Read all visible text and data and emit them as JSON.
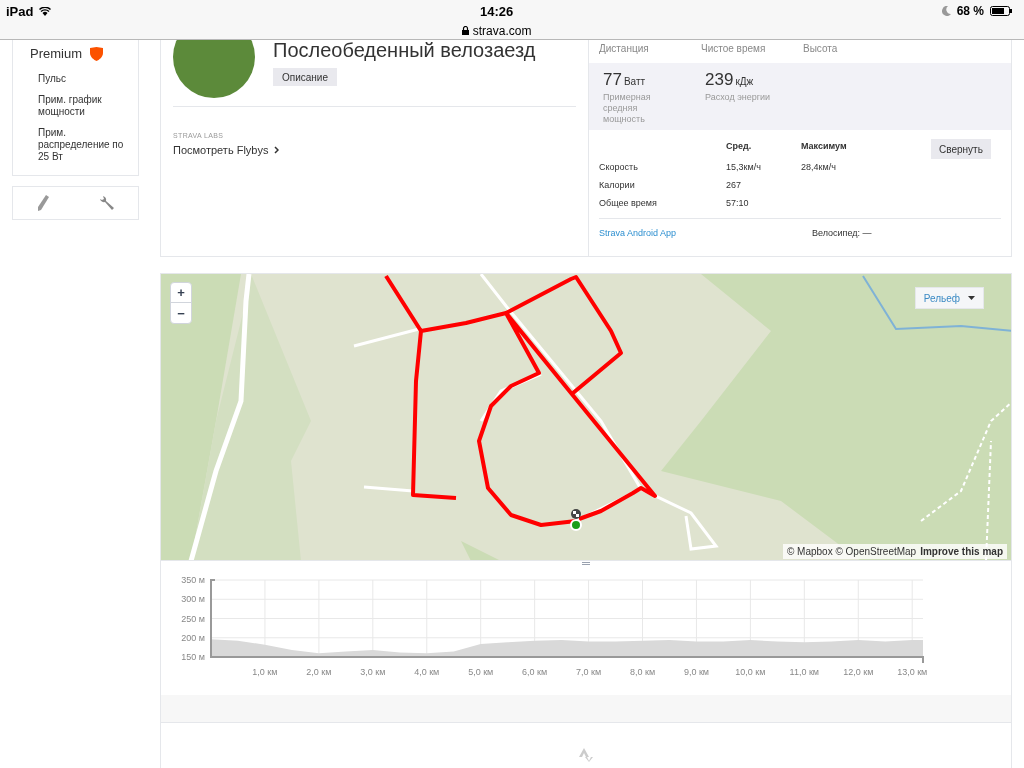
{
  "status_bar": {
    "device": "iPad",
    "time": "14:26",
    "url": "strava.com",
    "battery": "68 %"
  },
  "sidebar": {
    "premium": {
      "title": "Premium",
      "items": [
        "Пульс",
        "Прим. график мощности",
        "Прим. распределение по 25 Вт"
      ]
    }
  },
  "activity": {
    "title": "Послеобеденный велозаезд",
    "description_button": "Описание",
    "labs_label": "STRAVA LABS",
    "flybys_link": "Посмотреть Flybys"
  },
  "stats": [
    {
      "label": "Дистанция"
    },
    {
      "label": "Чистое время"
    },
    {
      "label": "Высота"
    }
  ],
  "secondary_stats": [
    {
      "value": "77",
      "unit": "Ватт",
      "label": "Примерная средняя мощность"
    },
    {
      "value": "239",
      "unit": "кДж",
      "label": "Расход энергии"
    }
  ],
  "details": {
    "columns": [
      "Сред.",
      "Максимум"
    ],
    "collapse_button": "Свернуть",
    "rows": [
      {
        "label": "Скорость",
        "avg": "15,3км/ч",
        "max": "28,4км/ч"
      },
      {
        "label": "Калории",
        "avg": "267"
      },
      {
        "label": "Общее время",
        "avg": "57:10"
      }
    ]
  },
  "footer": {
    "device": "Strava Android App",
    "bike": "Велосипед: —"
  },
  "map": {
    "zoom_in": "+",
    "zoom_out": "−",
    "layer_button": "Рельеф",
    "attribution": "© Mapbox © OpenStreetMap",
    "improve_link": "Improve this map"
  },
  "elevation": {
    "chart_data": {
      "type": "area",
      "xlim": [
        0,
        13.2
      ],
      "ylim": [
        150,
        350
      ],
      "x": [
        0,
        0.5,
        1,
        1.5,
        2,
        2.5,
        3,
        3.5,
        4,
        4.5,
        5,
        5.5,
        6,
        6.5,
        7,
        7.5,
        8,
        8.5,
        9,
        9.5,
        10,
        10.5,
        11,
        11.5,
        12,
        12.5,
        13,
        13.2
      ],
      "grid": true,
      "series": [
        {
          "color": "#d9d9d9",
          "values": [
            196,
            192,
            182,
            168,
            160,
            164,
            168,
            162,
            160,
            164,
            184,
            188,
            192,
            194,
            190,
            190,
            192,
            194,
            190,
            190,
            194,
            190,
            188,
            190,
            194,
            190,
            194,
            194
          ]
        }
      ],
      "yticks": [
        {
          "value": 150,
          "label": "150 м"
        },
        {
          "value": 200,
          "label": "200 м"
        },
        {
          "value": 250,
          "label": "250 м"
        },
        {
          "value": 300,
          "label": "300 м"
        },
        {
          "value": 350,
          "label": "350 м"
        }
      ],
      "xticks": [
        {
          "value": 1,
          "label": "1,0 км"
        },
        {
          "value": 2,
          "label": "2,0 км"
        },
        {
          "value": 3,
          "label": "3,0 км"
        },
        {
          "value": 4,
          "label": "4,0 км"
        },
        {
          "value": 5,
          "label": "5,0 км"
        },
        {
          "value": 6,
          "label": "6,0 км"
        },
        {
          "value": 7,
          "label": "7,0 км"
        },
        {
          "value": 8,
          "label": "8,0 км"
        },
        {
          "value": 9,
          "label": "9,0 км"
        },
        {
          "value": 10,
          "label": "10,0 км"
        },
        {
          "value": 11,
          "label": "11,0 км"
        },
        {
          "value": 12,
          "label": "12,0 км"
        },
        {
          "value": 13,
          "label": "13,0 км"
        }
      ]
    }
  }
}
